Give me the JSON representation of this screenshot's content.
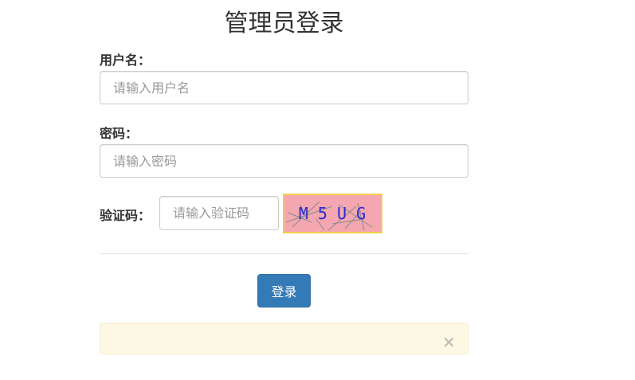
{
  "title": "管理员登录",
  "username": {
    "label": "用户名：",
    "placeholder": "请输入用户名",
    "value": ""
  },
  "password": {
    "label": "密码：",
    "placeholder": "请输入密码",
    "value": ""
  },
  "captcha": {
    "label": "验证码：",
    "placeholder": "请输入验证码",
    "value": "",
    "code": "M 5 U G"
  },
  "submit": {
    "label": "登录"
  },
  "alert": {
    "message": "",
    "close_label": "×"
  },
  "colors": {
    "primary": "#337ab7",
    "alert_bg": "#fcf8e3",
    "captcha_bg": "#f4a7b0",
    "captcha_border": "#f0d048",
    "captcha_text": "#2a2ad0"
  }
}
